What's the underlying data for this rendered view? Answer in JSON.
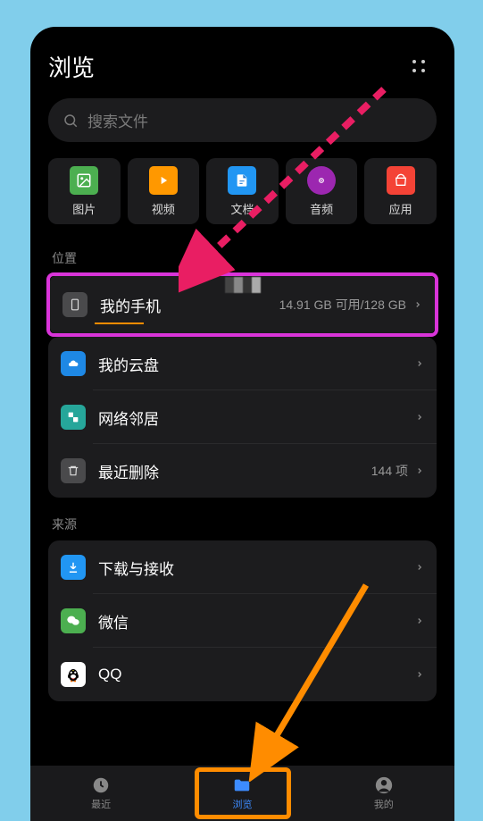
{
  "header": {
    "title": "浏览"
  },
  "search": {
    "placeholder": "搜索文件"
  },
  "categories": [
    {
      "label": "图片",
      "color": "#4caf50",
      "icon": "image"
    },
    {
      "label": "视频",
      "color": "#ff9800",
      "icon": "video"
    },
    {
      "label": "文档",
      "color": "#2196f3",
      "icon": "doc"
    },
    {
      "label": "音频",
      "color": "#9c27b0",
      "icon": "audio"
    },
    {
      "label": "应用",
      "color": "#f44336",
      "icon": "app"
    }
  ],
  "sections": {
    "location_label": "位置",
    "source_label": "来源"
  },
  "locations": {
    "phone": {
      "label": "我的手机",
      "meta": "14.91 GB 可用/128 GB"
    },
    "cloud": {
      "label": "我的云盘",
      "meta": ""
    },
    "network": {
      "label": "网络邻居",
      "meta": ""
    },
    "trash": {
      "label": "最近删除",
      "meta": "144 项"
    }
  },
  "sources": {
    "download": {
      "label": "下载与接收"
    },
    "wechat": {
      "label": "微信"
    },
    "qq": {
      "label": "QQ"
    }
  },
  "nav": {
    "recent": "最近",
    "browse": "浏览",
    "mine": "我的"
  }
}
